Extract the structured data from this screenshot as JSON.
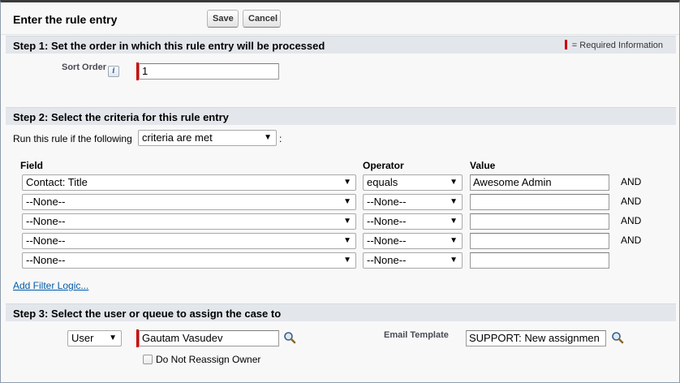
{
  "header": {
    "title": "Enter the rule entry",
    "save_label": "Save",
    "cancel_label": "Cancel"
  },
  "required_legend": "= Required Information",
  "step1": {
    "heading": "Step 1: Set the order in which this rule entry will be processed",
    "sort_order_label": "Sort Order",
    "info_icon": "info-icon",
    "sort_order_value": "1"
  },
  "step2": {
    "heading": "Step 2: Select the criteria for this rule entry",
    "run_prefix": "Run this rule if the following",
    "run_select": "criteria are met",
    "run_suffix": ":",
    "columns": {
      "field": "Field",
      "operator": "Operator",
      "value": "Value"
    },
    "rows": [
      {
        "field": "Contact: Title",
        "operator": "equals",
        "value": "Awesome Admin",
        "conj": "AND"
      },
      {
        "field": "--None--",
        "operator": "--None--",
        "value": "",
        "conj": "AND"
      },
      {
        "field": "--None--",
        "operator": "--None--",
        "value": "",
        "conj": "AND"
      },
      {
        "field": "--None--",
        "operator": "--None--",
        "value": "",
        "conj": "AND"
      },
      {
        "field": "--None--",
        "operator": "--None--",
        "value": "",
        "conj": ""
      }
    ],
    "add_filter_logic": "Add Filter Logic..."
  },
  "step3": {
    "heading": "Step 3: Select the user or queue to assign the case to",
    "assignee_type": "User",
    "assignee_value": "Gautam Vasudev",
    "do_not_reassign_label": "Do Not Reassign Owner",
    "do_not_reassign_checked": false,
    "email_template_label": "Email Template",
    "email_template_value": "SUPPORT:  New assignmen"
  },
  "colors": {
    "required": "#cc0000",
    "step_background": "#e3e7ec",
    "link": "#015ba7"
  }
}
